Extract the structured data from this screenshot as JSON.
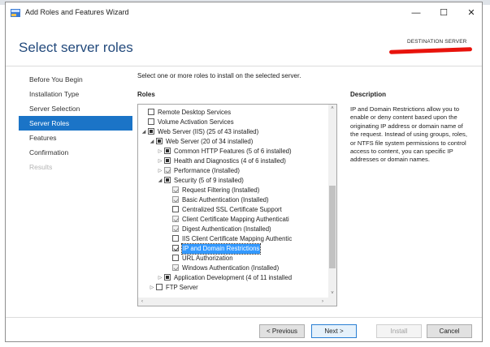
{
  "window": {
    "title": "Add Roles and Features Wizard",
    "controls": {
      "minimize": "—",
      "maximize": "☐",
      "close": "✕"
    }
  },
  "header": {
    "page_title": "Select server roles",
    "destination_label": "DESTINATION SERVER"
  },
  "steps": [
    {
      "label": "Before You Begin",
      "state": "normal"
    },
    {
      "label": "Installation Type",
      "state": "normal"
    },
    {
      "label": "Server Selection",
      "state": "normal"
    },
    {
      "label": "Server Roles",
      "state": "active"
    },
    {
      "label": "Features",
      "state": "normal"
    },
    {
      "label": "Confirmation",
      "state": "normal"
    },
    {
      "label": "Results",
      "state": "disabled"
    }
  ],
  "main": {
    "instructions": "Select one or more roles to install on the selected server.",
    "roles_heading": "Roles",
    "description_heading": "Description",
    "description": "IP and Domain Restrictions allow you to enable or deny content based upon the originating IP address or domain name of the request. Instead of using groups, roles, or NTFS file system permissions to control access to content, you can specific IP addresses or domain names."
  },
  "roles_tree": [
    {
      "label": "Remote Desktop Services",
      "level": 1,
      "expander": "",
      "check": "unchecked"
    },
    {
      "label": "Volume Activation Services",
      "level": 1,
      "expander": "",
      "check": "unchecked"
    },
    {
      "label": "Web Server (IIS) (25 of 43 installed)",
      "level": 1,
      "expander": "expanded",
      "check": "partial"
    },
    {
      "label": "Web Server (20 of 34 installed)",
      "level": 2,
      "expander": "expanded",
      "check": "partial"
    },
    {
      "label": "Common HTTP Features (5 of 6 installed)",
      "level": 3,
      "expander": "collapsed",
      "check": "partial"
    },
    {
      "label": "Health and Diagnostics (4 of 6 installed)",
      "level": 3,
      "expander": "collapsed",
      "check": "partial"
    },
    {
      "label": "Performance (Installed)",
      "level": 3,
      "expander": "collapsed",
      "check": "installed"
    },
    {
      "label": "Security (5 of 9 installed)",
      "level": 3,
      "expander": "expanded",
      "check": "partial"
    },
    {
      "label": "Request Filtering (Installed)",
      "level": 4,
      "expander": "",
      "check": "installed"
    },
    {
      "label": "Basic Authentication (Installed)",
      "level": 4,
      "expander": "",
      "check": "installed"
    },
    {
      "label": "Centralized SSL Certificate Support",
      "level": 4,
      "expander": "",
      "check": "unchecked"
    },
    {
      "label": "Client Certificate Mapping Authenticati",
      "level": 4,
      "expander": "",
      "check": "installed"
    },
    {
      "label": "Digest Authentication (Installed)",
      "level": 4,
      "expander": "",
      "check": "installed"
    },
    {
      "label": "IIS Client Certificate Mapping Authentic",
      "level": 4,
      "expander": "",
      "check": "unchecked"
    },
    {
      "label": "IP and Domain Restrictions",
      "level": 4,
      "expander": "",
      "check": "checked",
      "selected": true
    },
    {
      "label": "URL Authorization",
      "level": 4,
      "expander": "",
      "check": "unchecked"
    },
    {
      "label": "Windows Authentication (Installed)",
      "level": 4,
      "expander": "",
      "check": "installed"
    },
    {
      "label": "Application Development (4 of 11 installed",
      "level": 3,
      "expander": "collapsed",
      "check": "partial"
    },
    {
      "label": "FTP Server",
      "level": 2,
      "expander": "collapsed",
      "check": "unchecked"
    }
  ],
  "footer": {
    "previous": "< Previous",
    "next": "Next >",
    "install": "Install",
    "cancel": "Cancel"
  },
  "scroll_glyphs": {
    "up": "˄",
    "down": "˅",
    "left": "‹",
    "right": "›"
  },
  "colors": {
    "accent": "#1b74c7",
    "title_blue": "#234a7c",
    "selection": "#3399ff",
    "redaction": "#e8130c"
  },
  "icons": {
    "app": "server-manager-icon",
    "expanded": "triangle-down-icon",
    "collapsed": "triangle-right-icon"
  }
}
